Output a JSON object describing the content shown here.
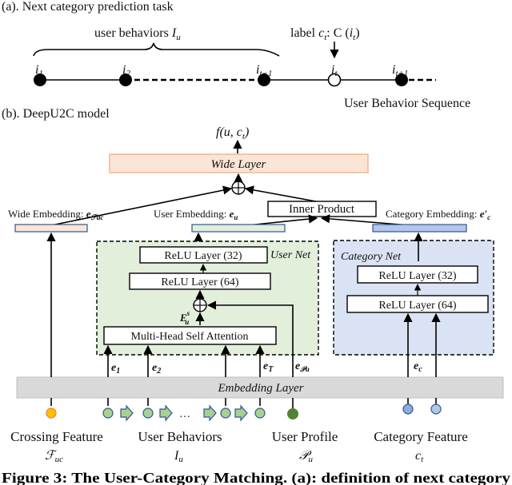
{
  "panel_a": {
    "title": "(a). Next category prediction task",
    "brace_label": "user behaviors ",
    "brace_symbol": "I",
    "brace_sub": "u",
    "label_prefix": "label ",
    "label_math": "c",
    "label_sub": "t",
    "label_rest": ": C (",
    "label_i": "i",
    "label_i_sub": "t",
    "label_close": ")",
    "nodes": [
      {
        "name": "i",
        "sub": "1",
        "filled": true
      },
      {
        "name": "i",
        "sub": "2",
        "filled": true
      },
      {
        "name": "i",
        "sub": "t−1",
        "filled": true
      },
      {
        "name": "i",
        "sub": "t",
        "filled": false
      },
      {
        "name": "i",
        "sub": "t+1",
        "filled": true
      }
    ],
    "sequence_label": "User Behavior Sequence"
  },
  "panel_b": {
    "title": "(b). DeepU2C model",
    "output_label": "f(u, c",
    "output_sub": "t",
    "output_close": ")",
    "wide_layer": "Wide Layer",
    "inner_product": "Inner Product",
    "wide_embedding": "Wide Embedding: ",
    "wide_embedding_sym": "e",
    "wide_embedding_sub": "ℱuc",
    "user_embedding": "User Embedding: ",
    "user_embedding_sym": "e",
    "user_embedding_sub": "u",
    "category_embedding": "Category Embedding: ",
    "category_embedding_sym": "e′",
    "category_embedding_sub": "c",
    "user_net_label": "User Net",
    "category_net_label": "Category Net",
    "user_relu_32": "ReLU Layer (32)",
    "user_relu_64": "ReLU Layer (64)",
    "attention": "Multi-Head Self Attention",
    "es_label": "E",
    "es_sup": "s",
    "es_sub": "u",
    "cat_relu_32": "ReLU Layer (32)",
    "cat_relu_64": "ReLU Layer (64)",
    "embedding_layer": "Embedding Layer",
    "edge_labels": {
      "e1": "e",
      "e1_sub": "1",
      "e2": "e",
      "e2_sub": "2",
      "eT": "e",
      "eT_sub": "T",
      "eP": "e",
      "eP_sub": "𝒫u",
      "ec": "e",
      "ec_sub": "c"
    },
    "ellipsis": "…",
    "inputs": {
      "crossing": {
        "label": "Crossing Feature",
        "sym": "ℱ",
        "sub": "uc",
        "color": "#f5a623"
      },
      "behaviors": {
        "label": "User Behaviors",
        "sym": "I",
        "sub": "u",
        "color": "#a9d18e"
      },
      "profile": {
        "label": "User Profile",
        "sym": "𝒫",
        "sub": "u",
        "color": "#548235"
      },
      "category": {
        "label": "Category Feature",
        "sym": "c",
        "sub": "t",
        "color": "#b4c7e7"
      }
    }
  },
  "colors": {
    "wide_fill": "#fbe5d6",
    "wide_stroke": "#f4b183",
    "user_net_fill": "#e2efda",
    "category_net_fill": "#dae3f3",
    "cat_emb_fill": "#b4c7e7",
    "embedding_layer_fill": "#d9d9d9",
    "emb_stroke": "#2f5597"
  },
  "caption": "Figure 3: The User-Category Matching. (a): definition of next category"
}
